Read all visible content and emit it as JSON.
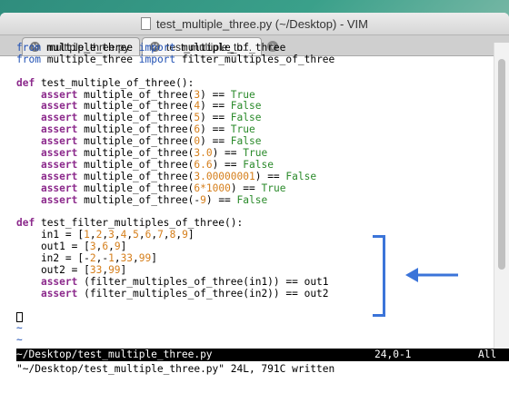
{
  "window": {
    "title": "test_multiple_three.py (~/Desktop) - VIM"
  },
  "tabs": [
    {
      "label": "multiple_three.py",
      "active": false
    },
    {
      "label": "test_multiple_th...",
      "active": true
    }
  ],
  "code_lines": [
    "from multiple_three import multiple_of_three",
    "from multiple_three import filter_multiples_of_three",
    "",
    "def test_multiple_of_three():",
    "    assert multiple_of_three(3) == True",
    "    assert multiple_of_three(4) == False",
    "    assert multiple_of_three(5) == False",
    "    assert multiple_of_three(6) == True",
    "    assert multiple_of_three(0) == False",
    "    assert multiple_of_three(3.0) == True",
    "    assert multiple_of_three(6.6) == False",
    "    assert multiple_of_three(3.00000001) == False",
    "    assert multiple_of_three(6*1000) == True",
    "    assert multiple_of_three(-9) == False",
    "",
    "def test_filter_multiples_of_three():",
    "    in1 = [1,2,3,4,5,6,7,8,9]",
    "    out1 = [3,6,9]",
    "    in2 = [-2,-1,33,99]",
    "    out2 = [33,99]",
    "    assert (filter_multiples_of_three(in1)) == out1",
    "    assert (filter_multiples_of_three(in2)) == out2",
    "",
    "",
    "~",
    "~"
  ],
  "statusline": {
    "filename": "~/Desktop/test_multiple_three.py",
    "position": "24,0-1",
    "percent": "All"
  },
  "cmdline": "\"~/Desktop/test_multiple_three.py\" 24L, 791C written",
  "colors": {
    "keyword_from": "#1e4fb3",
    "keyword": "#8c2a8c",
    "number": "#d57e1a",
    "boolean": "#2a8a2a",
    "annotation": "#3b74d9"
  },
  "icons": {
    "file": "file-icon",
    "close": "close-icon",
    "add": "plus-icon"
  }
}
